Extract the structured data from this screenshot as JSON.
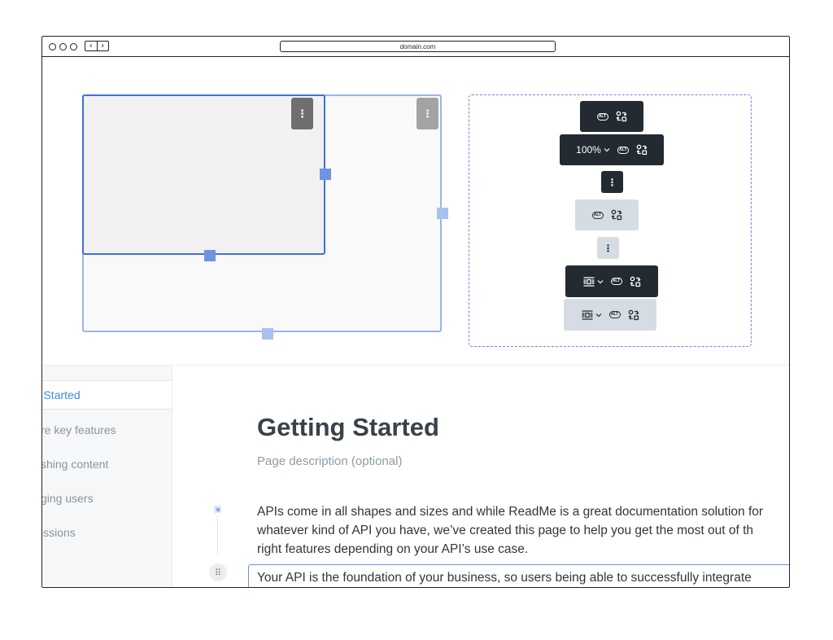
{
  "browser": {
    "url": "domain.com",
    "back_glyph": "‹",
    "forward_glyph": "›"
  },
  "canvas": {
    "image_menu_glyph": "⋮"
  },
  "toolbars": {
    "zoom_value": "100%",
    "alt_label": "ALT",
    "kebab_glyph": "⋮"
  },
  "sidebar": {
    "items": [
      {
        "label": "Getting Started",
        "active": true
      },
      {
        "label": "Explore key features",
        "active": false
      },
      {
        "label": "Publishing content",
        "active": false
      },
      {
        "label": "Managing users",
        "active": false
      },
      {
        "label": "Permissions",
        "active": false
      }
    ],
    "visible_labels": [
      "ng Started",
      "re key features",
      "shing content",
      "ging users",
      "issions"
    ]
  },
  "page": {
    "title": "Getting Started",
    "description": "Page description (optional)",
    "paragraph_lines": [
      "APIs come in all shapes and sizes and while ReadMe is a great documentation solution for",
      "whatever kind of API you have, we’ve created this page to help you get the most out of th",
      "right features depending on your API’s use case."
    ],
    "selected_paragraph": "Your API is the foundation of your business, so users being able to successfully integrate",
    "drag_glyph": "⠿"
  },
  "colors": {
    "selection_blue": "#3d72d6",
    "handle_blue": "#6e93e0",
    "dashed_purple": "#a66bea",
    "toolbar_dark": "#232a31",
    "toolbar_light": "#d6dce3",
    "link_blue": "#3a8de6"
  },
  "icons": [
    "alt-text-icon",
    "replace-image-icon",
    "align-icon",
    "chevron-down-icon",
    "kebab-icon",
    "drag-handle-icon"
  ]
}
